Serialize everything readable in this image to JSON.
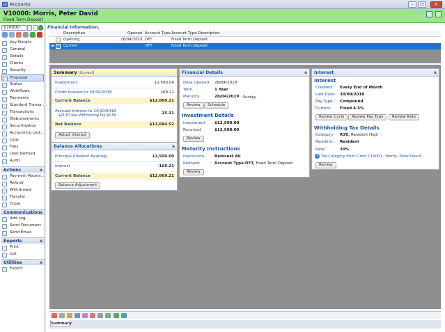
{
  "window": {
    "title": "Accounts"
  },
  "header": {
    "title": "V10000: Morris, Peter David",
    "subtitle": "Fixed Term Deposit"
  },
  "account_box": {
    "value": "V10000"
  },
  "nav": {
    "items": [
      {
        "label": "Key Details"
      },
      {
        "label": "General"
      },
      {
        "label": "Details"
      },
      {
        "label": "Clients"
      },
      {
        "label": "Security"
      },
      {
        "label": "Financial"
      },
      {
        "label": "Status"
      },
      {
        "label": "Workflows"
      },
      {
        "label": "Payments"
      },
      {
        "label": "Standard Transa..."
      },
      {
        "label": "Transactions"
      },
      {
        "label": "Disbursements"
      },
      {
        "label": "Securitisation"
      },
      {
        "label": "Accounting Led..."
      },
      {
        "label": "Logs"
      },
      {
        "label": "Files"
      },
      {
        "label": "User Defined"
      },
      {
        "label": "Audit"
      }
    ],
    "actions_title": "Actions",
    "actions": [
      {
        "label": "Payment Receiv..."
      },
      {
        "label": "Refund"
      },
      {
        "label": "Withdrawal"
      },
      {
        "label": "Transfer"
      },
      {
        "label": "Close"
      }
    ],
    "communication_title": "Communication",
    "communication": [
      {
        "label": "Add Log"
      },
      {
        "label": "Send Document"
      },
      {
        "label": "Send Email"
      }
    ],
    "reports_title": "Reports",
    "reports": [
      {
        "label": "Print"
      },
      {
        "label": "List"
      }
    ],
    "utilities_title": "Utilities",
    "utilities": [
      {
        "label": "Export"
      }
    ]
  },
  "financial": {
    "heading": "Financial Information.",
    "columns": {
      "description": "Description",
      "opened": "Opened",
      "account_type": "Account Type",
      "account_type_desc": "Account Type Description"
    },
    "rows": [
      {
        "description": "Opening",
        "opened": "28/04/2018",
        "account_type": "DFT",
        "account_type_desc": "Fixed Term Deposit"
      },
      {
        "description": "Current",
        "opened": "",
        "account_type": "DFT",
        "account_type_desc": "Fixed Term Deposit"
      }
    ]
  },
  "summary": {
    "title": "Summary",
    "subtitle": "(Current)",
    "investment_label": "Investment",
    "investment_value": "12,500.00",
    "credit_label": "Credit Interest to 30/09/2018",
    "credit_value": "169.21",
    "current_balance_label": "Current Balance",
    "current_balance_value": "$12,669.21",
    "accrued_label": "Accrued Interest to 14/10/2018",
    "accrued_note": "$21.87 less Withholding Tax $6.56",
    "accrued_value": "15.31",
    "net_balance_label": "Net Balance",
    "net_balance_value": "$12,684.52",
    "adjust_button": "Adjust Interest"
  },
  "balance_allocations": {
    "title": "Balance Allocations",
    "principal_label": "Principal (Interest Bearing)",
    "principal_value": "12,500.00",
    "interest_label": "Interest",
    "interest_value": "169.21",
    "current_label": "Current Balance",
    "current_value": "$12,669.21",
    "adjust_button": "Balance Adjustment"
  },
  "financial_details": {
    "title": "Financial Details",
    "date_opened_label": "Date Opened",
    "date_opened": "28/04/2018",
    "term_label": "Term",
    "term": "1 Year",
    "maturity_label": "Maturity",
    "maturity": "28/04/2019",
    "maturity_day": "Sunday",
    "review_button": "Review",
    "schedule_button": "Schedule",
    "investment_heading": "Investment Details",
    "investment_label": "Investment",
    "investment": "$12,500.00",
    "received_label": "Received",
    "received": "$12,500.00",
    "review2_button": "Review",
    "maturity_heading": "Maturity Instructions",
    "instruction_label": "Instruction",
    "instruction": "Reinvest All",
    "reinvest_label": "Reinvest",
    "reinvest_bold": "Account Type DFT,",
    "reinvest_rest": "Fixed Term Deposit",
    "review3_button": "Review"
  },
  "interest": {
    "title": "Interest",
    "heading": "Interest",
    "credited_label": "Credited:",
    "credited": "Every End of Month",
    "last_date_label": "Last Date:",
    "last_date": "30/09/2018",
    "pay_type_label": "Pay Type:",
    "pay_type": "Compound",
    "current_label": "Current:",
    "current": "Fixed 4.5%",
    "btn_cycle": "Review Cycle",
    "btn_pay_type": "Review Pay Type",
    "btn_rate": "Review Rate",
    "wht_heading": "Withholding Tax Details",
    "category_label": "Category:",
    "category_bold": "R30,",
    "category_rest": "Resident High",
    "resident_label": "Resident:",
    "resident": "Resident",
    "rate_label": "Rate:",
    "rate": "30%",
    "info": "Tax Category from Client C10001, 'Morris, Peter David'.",
    "review_button": "Review"
  },
  "bottom": {
    "tab": "Summary"
  },
  "colors": {
    "header_bg": "#9be68b",
    "accent": "#1a4fa0",
    "selected_row": "#1874d2",
    "highlight": "#fff4cc"
  }
}
